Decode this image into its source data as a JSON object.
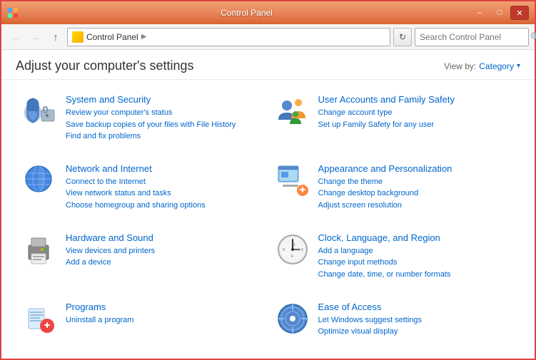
{
  "window": {
    "title": "Control Panel",
    "icon": "control-panel-icon"
  },
  "titlebar": {
    "minimize_label": "–",
    "maximize_label": "□",
    "close_label": "✕"
  },
  "addressbar": {
    "back_tooltip": "Back",
    "forward_tooltip": "Forward",
    "up_tooltip": "Up",
    "breadcrumb_icon": "folder-icon",
    "breadcrumb_root": "Control Panel",
    "breadcrumb_arrow": "▶",
    "refresh_symbol": "↻",
    "search_placeholder": "Search Control Panel"
  },
  "content": {
    "title": "Adjust your computer's settings",
    "view_by_label": "View by:",
    "view_by_value": "Category",
    "view_by_arrow": "▾"
  },
  "sections": [
    {
      "id": "system-security",
      "title": "System and Security",
      "links": [
        "Review your computer's status",
        "Save backup copies of your files with File History",
        "Find and fix problems"
      ],
      "icon_type": "shield"
    },
    {
      "id": "user-accounts",
      "title": "User Accounts and Family Safety",
      "links": [
        "Change account type",
        "Set up Family Safety for any user"
      ],
      "icon_type": "users"
    },
    {
      "id": "network-internet",
      "title": "Network and Internet",
      "links": [
        "Connect to the Internet",
        "View network status and tasks",
        "Choose homegroup and sharing options"
      ],
      "icon_type": "globe"
    },
    {
      "id": "appearance",
      "title": "Appearance and Personalization",
      "links": [
        "Change the theme",
        "Change desktop background",
        "Adjust screen resolution"
      ],
      "icon_type": "appearance"
    },
    {
      "id": "hardware-sound",
      "title": "Hardware and Sound",
      "links": [
        "View devices and printers",
        "Add a device"
      ],
      "icon_type": "printer"
    },
    {
      "id": "clock-language",
      "title": "Clock, Language, and Region",
      "links": [
        "Add a language",
        "Change input methods",
        "Change date, time, or number formats"
      ],
      "icon_type": "clock"
    },
    {
      "id": "programs",
      "title": "Programs",
      "links": [
        "Uninstall a program"
      ],
      "icon_type": "programs"
    },
    {
      "id": "ease-of-access",
      "title": "Ease of Access",
      "links": [
        "Let Windows suggest settings",
        "Optimize visual display"
      ],
      "icon_type": "ease"
    }
  ]
}
